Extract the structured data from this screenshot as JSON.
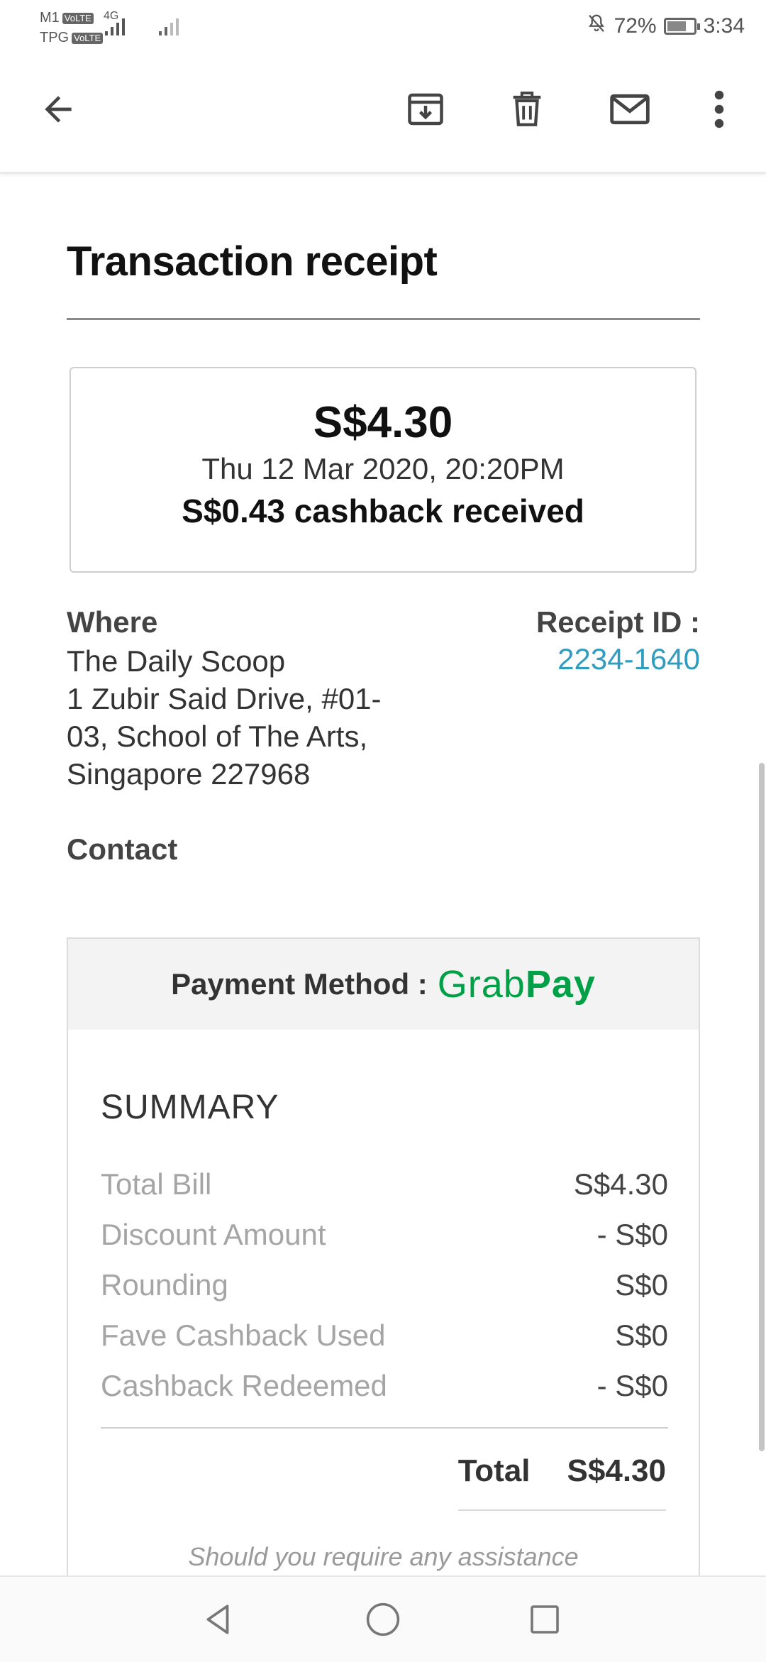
{
  "status_bar": {
    "carrier1": "M1",
    "carrier2": "TPG",
    "volte": "VoLTE",
    "network": "4G",
    "battery_percent": "72%",
    "battery_level": 0.72,
    "time": "3:34",
    "icons": [
      "mute-icon",
      "signal-icon",
      "battery-icon"
    ]
  },
  "toolbar": {
    "icons": [
      "back-arrow-icon",
      "archive-icon",
      "trash-icon",
      "mail-icon",
      "more-vert-icon"
    ]
  },
  "receipt": {
    "title": "Transaction receipt",
    "amount": "S$4.30",
    "datetime": "Thu 12 Mar 2020, 20:20PM",
    "cashback": "S$0.43 cashback received",
    "where_label": "Where",
    "merchant": "The Daily Scoop",
    "address": "1 Zubir Said Drive, #01-03, School of The Arts, Singapore 227968",
    "receipt_id_label": "Receipt ID :",
    "receipt_id": "2234-1640",
    "contact_label": "Contact"
  },
  "payment": {
    "label": "Payment Method :",
    "method_part1": "Grab",
    "method_part2": "Pay",
    "brand_color": "#00a047"
  },
  "summary": {
    "title": "SUMMARY",
    "rows": [
      {
        "label": "Total Bill",
        "value": "S$4.30"
      },
      {
        "label": "Discount Amount",
        "value": "- S$0"
      },
      {
        "label": "Rounding",
        "value": "S$0"
      },
      {
        "label": "Fave Cashback Used",
        "value": "S$0"
      },
      {
        "label": "Cashback Redeemed",
        "value": "- S$0"
      }
    ],
    "total_label": "Total",
    "total_value": "S$4.30",
    "assistance": "Should you require any assistance"
  },
  "nav_bar": {
    "icons": [
      "back-triangle-icon",
      "home-circle-icon",
      "recents-square-icon"
    ]
  }
}
